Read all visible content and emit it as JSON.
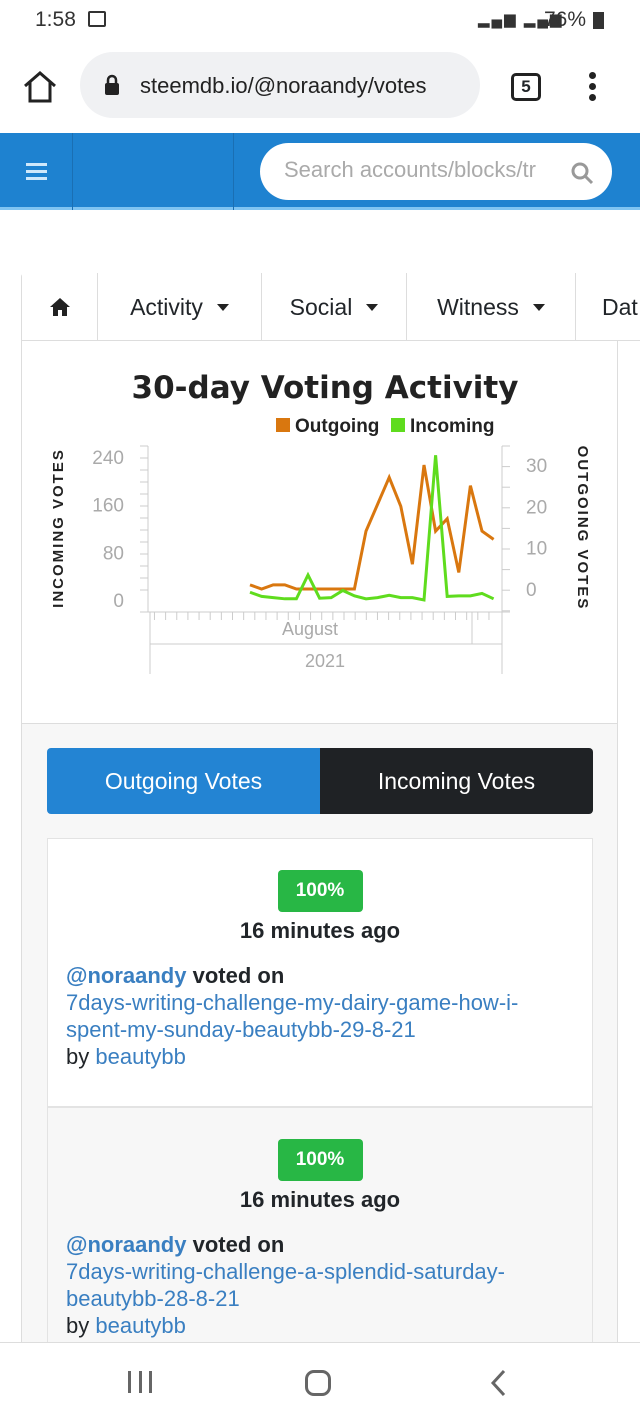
{
  "status": {
    "time": "1:58",
    "battery": "76%"
  },
  "browser": {
    "url": "steemdb.io/@noraandy/votes",
    "tab_count": "5"
  },
  "nav": {
    "search_placeholder": "Search accounts/blocks/tr"
  },
  "tabs": [
    {
      "label": "Activity"
    },
    {
      "label": "Social"
    },
    {
      "label": "Witness"
    },
    {
      "label": "Dat"
    }
  ],
  "chart_data": {
    "type": "line",
    "title": "30-day Voting Activity",
    "legend": [
      "Outgoing",
      "Incoming"
    ],
    "legend_placement": "top-right",
    "left_axis_label": "INCOMING VOTES",
    "right_axis_label": "OUTGOING VOTES",
    "left_ticks": [
      "0",
      "80",
      "160",
      "240"
    ],
    "right_ticks": [
      "0",
      "10",
      "20",
      "30"
    ],
    "x_month_label": "August",
    "x_year_label": "2021",
    "colors": {
      "Outgoing": "#d9770f",
      "Incoming": "#5fdc1e"
    },
    "series": [
      {
        "name": "Outgoing",
        "axis": "right",
        "values": [
          1,
          0,
          1,
          1,
          0,
          0,
          0,
          0,
          0,
          0,
          14,
          20.5,
          27,
          20,
          6,
          30,
          14,
          17,
          4,
          25,
          14,
          12
        ]
      },
      {
        "name": "Incoming",
        "axis": "left",
        "values": [
          13,
          6,
          4,
          2,
          2,
          42,
          3,
          4,
          16,
          7,
          2,
          4,
          8,
          4,
          4,
          0,
          243,
          6,
          7,
          7,
          11,
          2
        ]
      }
    ]
  },
  "toggle": {
    "outgoing": "Outgoing Votes",
    "incoming": "Incoming Votes"
  },
  "votes": [
    {
      "weight": "100%",
      "ago": "16 minutes ago",
      "voter": "@noraandy",
      "verb": "voted on",
      "post": "7days-writing-challenge-my-dairy-game-how-i-spent-my-sunday-beautybb-29-8-21",
      "by": "by",
      "author": "beautybb"
    },
    {
      "weight": "100%",
      "ago": "16 minutes ago",
      "voter": "@noraandy",
      "verb": "voted on",
      "post": "7days-writing-challenge-a-splendid-saturday-beautybb-28-8-21",
      "by": "by",
      "author": "beautybb"
    }
  ]
}
